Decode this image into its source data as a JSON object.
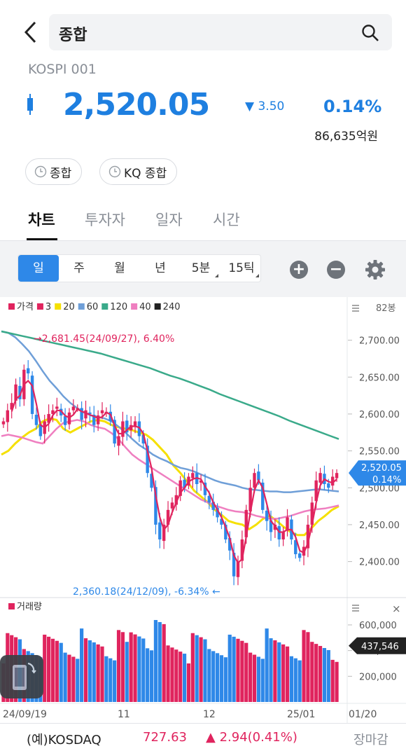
{
  "header": {
    "back_icon": "chevron-left-icon",
    "search_text": "종합",
    "search_icon": "search-icon"
  },
  "quote": {
    "code": "KOSPI 001",
    "price": "2,520.05",
    "change": "3.50",
    "change_direction": "down",
    "percent": "0.14%",
    "amount": "86,635억원",
    "color": "#1e7fe0"
  },
  "chips": [
    {
      "label": "종합"
    },
    {
      "label": "KQ 종합"
    }
  ],
  "tabs": [
    {
      "label": "차트",
      "active": true
    },
    {
      "label": "투자자"
    },
    {
      "label": "일자"
    },
    {
      "label": "시간"
    }
  ],
  "periods": [
    {
      "label": "일",
      "active": true
    },
    {
      "label": "주"
    },
    {
      "label": "월"
    },
    {
      "label": "년"
    },
    {
      "label": "5분"
    },
    {
      "label": "15틱"
    }
  ],
  "legend": [
    {
      "label": "가격",
      "color": "#e0245e"
    },
    {
      "label": "3",
      "color": "#e0245e"
    },
    {
      "label": "20",
      "color": "#f5e000"
    },
    {
      "label": "60",
      "color": "#6f9fd8"
    },
    {
      "label": "120",
      "color": "#3aaa8a"
    },
    {
      "label": "40",
      "color": "#ef7fc0"
    },
    {
      "label": "240",
      "color": "#222222"
    }
  ],
  "chart_data": {
    "type": "candlestick",
    "bar_count_label": "82봉",
    "y_ticks": [
      "2,700.00",
      "2,650.00",
      "2,600.00",
      "2,550.00",
      "2,500.00",
      "2,450.00",
      "2,400.00"
    ],
    "ylim": [
      2355,
      2730
    ],
    "x_ticks": [
      "24/09/19",
      "11",
      "12",
      "25/01",
      "01/20"
    ],
    "high_annotation": "2,681.45(24/09/27), 6.40%",
    "low_annotation": "2,360.18(24/12/09), -6.34%",
    "last_price_label": "2,520.05",
    "last_pct_label": "0.14%",
    "closes": [
      2590,
      2605,
      2615,
      2640,
      2620,
      2660,
      2655,
      2600,
      2585,
      2570,
      2590,
      2600,
      2605,
      2610,
      2598,
      2585,
      2602,
      2610,
      2608,
      2592,
      2605,
      2600,
      2585,
      2598,
      2605,
      2603,
      2590,
      2560,
      2570,
      2590,
      2575,
      2585,
      2590,
      2570,
      2560,
      2520,
      2500,
      2450,
      2430,
      2450,
      2470,
      2480,
      2490,
      2510,
      2500,
      2515,
      2520,
      2505,
      2510,
      2490,
      2480,
      2470,
      2460,
      2450,
      2430,
      2415,
      2380,
      2400,
      2430,
      2470,
      2500,
      2520,
      2510,
      2470,
      2455,
      2440,
      2450,
      2430,
      2440,
      2460,
      2430,
      2410,
      2405,
      2420,
      2450,
      2480,
      2510,
      2520,
      2505,
      2500,
      2515,
      2520
    ],
    "ma_series": [
      {
        "name": "20",
        "color": "#f5e000",
        "values": [
          2545,
          2550,
          2560,
          2568,
          2575,
          2580,
          2590,
          2594,
          2592,
          2580,
          2575,
          2580,
          2585,
          2590,
          2592,
          2590,
          2585,
          2582,
          2580,
          2578,
          2575,
          2572,
          2565,
          2555,
          2545,
          2530,
          2520,
          2508,
          2496,
          2488,
          2480,
          2470,
          2463,
          2455,
          2452,
          2450,
          2444,
          2450,
          2458,
          2462,
          2455,
          2447,
          2440,
          2436,
          2436,
          2445,
          2455,
          2462,
          2470,
          2475
        ]
      },
      {
        "name": "60",
        "color": "#6f9fd8",
        "values": [
          2712,
          2710,
          2704,
          2695,
          2685,
          2672,
          2658,
          2645,
          2635,
          2624,
          2615,
          2608,
          2602,
          2598,
          2596,
          2594,
          2590,
          2583,
          2575,
          2566,
          2558,
          2552,
          2545,
          2540,
          2536,
          2531,
          2527,
          2525,
          2522,
          2518,
          2514,
          2510,
          2507,
          2505,
          2503,
          2500,
          2498,
          2497,
          2496,
          2495,
          2495,
          2494,
          2494,
          2495,
          2496,
          2497,
          2498,
          2497,
          2496,
          2495
        ]
      },
      {
        "name": "40",
        "color": "#ef7fc0",
        "values": [
          2570,
          2572,
          2570,
          2568,
          2565,
          2562,
          2560,
          2570,
          2580,
          2588,
          2590,
          2592,
          2590,
          2585,
          2582,
          2580,
          2574,
          2566,
          2555,
          2545,
          2538,
          2532,
          2526,
          2520,
          2514,
          2508,
          2502,
          2496,
          2490,
          2484,
          2480,
          2476,
          2473,
          2470,
          2468,
          2467,
          2465,
          2462,
          2460,
          2458,
          2458,
          2460,
          2462,
          2465,
          2468,
          2470,
          2471,
          2472,
          2474,
          2476
        ]
      },
      {
        "name": "120",
        "color": "#3aaa8a",
        "values": [
          2712,
          2709,
          2706,
          2703,
          2700,
          2697,
          2694,
          2691,
          2688,
          2685,
          2682,
          2678,
          2674,
          2670,
          2666,
          2662,
          2657,
          2652,
          2648,
          2643,
          2638,
          2633,
          2627,
          2622,
          2617,
          2612,
          2607,
          2602,
          2597,
          2591,
          2586,
          2581,
          2576,
          2571,
          2566
        ]
      }
    ]
  },
  "volume": {
    "label": "거래량",
    "y_ticks": [
      "600,000",
      "400,000",
      "200,000"
    ],
    "last_label": "437,546",
    "ylim": [
      0,
      720000
    ]
  },
  "bottom_ticker": {
    "name": "(예)KOSDAQ",
    "price": "727.63",
    "change": "▲ 2.94(0.41%)",
    "status": "장마감",
    "color": "#e0245e"
  }
}
